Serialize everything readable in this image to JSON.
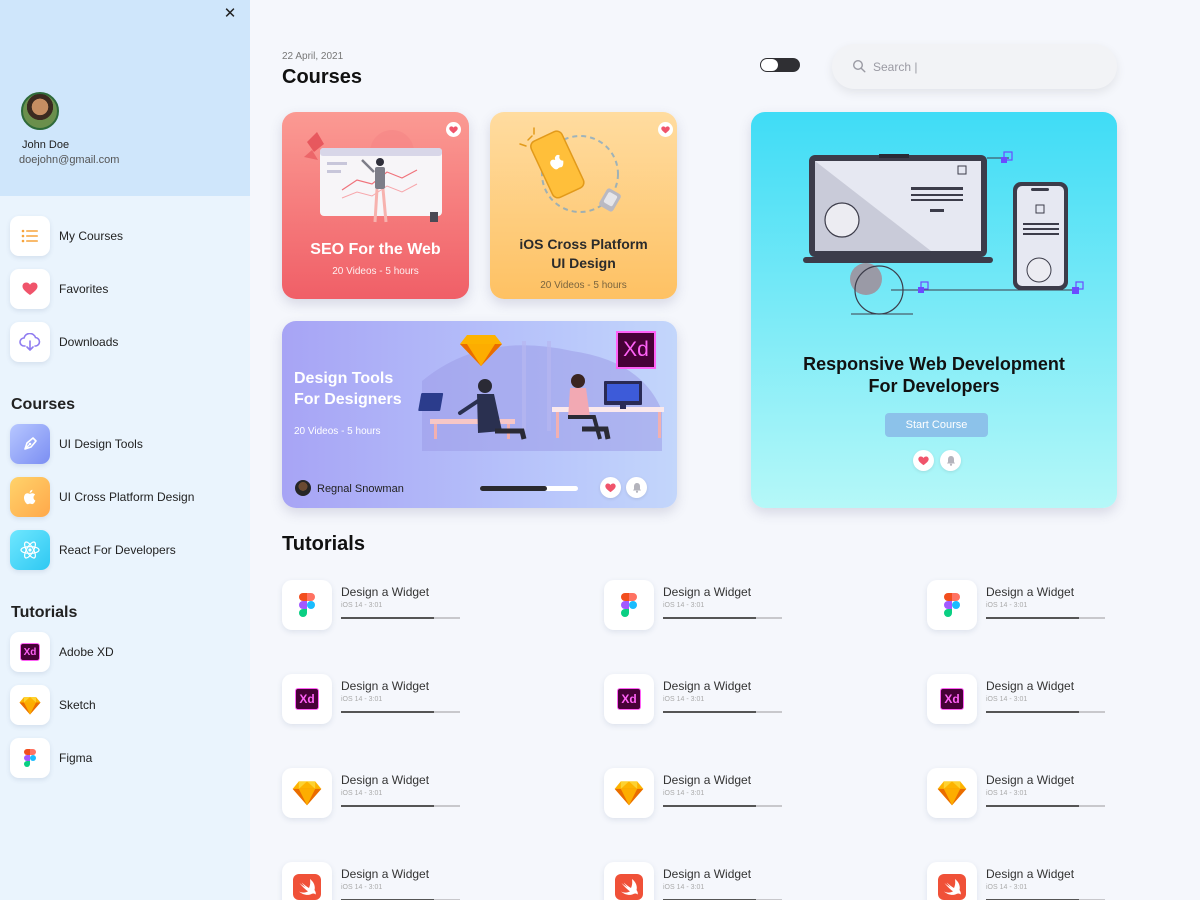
{
  "user": {
    "name": "John Doe",
    "email": "doejohn@gmail.com"
  },
  "close_icon": "✕",
  "sidebar": {
    "main_items": [
      {
        "label": "My Courses",
        "icon": "list-icon"
      },
      {
        "label": "Favorites",
        "icon": "heart-icon"
      },
      {
        "label": "Downloads",
        "icon": "cloud-download-icon"
      }
    ],
    "courses_heading": "Courses",
    "course_items": [
      {
        "label": "UI Design Tools",
        "icon": "pen-tool-icon"
      },
      {
        "label": "UI Cross Platform Design",
        "icon": "apple-icon"
      },
      {
        "label": "React For Developers",
        "icon": "react-icon"
      }
    ],
    "tutorials_heading": "Tutorials",
    "tutorial_items": [
      {
        "label": "Adobe XD",
        "icon": "adobe-xd-icon"
      },
      {
        "label": "Sketch",
        "icon": "sketch-icon"
      },
      {
        "label": "Figma",
        "icon": "figma-icon"
      }
    ]
  },
  "header": {
    "date": "22 April, 2021",
    "title": "Courses",
    "search_placeholder": "Search |"
  },
  "cards": {
    "seo": {
      "title": "SEO For the Web",
      "meta": "20 Videos - 5 hours"
    },
    "ios": {
      "title_line1": "iOS Cross Platform",
      "title_line2": "UI Design",
      "meta": "20 Videos - 5 hours"
    },
    "tools": {
      "xd_badge": "Xd",
      "title_line1": "Design Tools",
      "title_line2": "For Designers",
      "meta": "20 Videos - 5 hours",
      "author": "Regnal Snowman",
      "progress": 0.68
    },
    "web": {
      "title_line1": "Responsive Web Development",
      "title_line2": "For Developers",
      "button": "Start Course"
    }
  },
  "tutorials": {
    "heading": "Tutorials",
    "rows": [
      {
        "icon": "figma-icon",
        "items": [
          {
            "name": "Design a Widget",
            "meta": "iOS 14 - 3:01",
            "progress": 0.78
          },
          {
            "name": "Design a Widget",
            "meta": "iOS 14 - 3:01",
            "progress": 0.78
          },
          {
            "name": "Design a Widget",
            "meta": "iOS 14 - 3:01",
            "progress": 0.78
          }
        ]
      },
      {
        "icon": "adobe-xd-icon",
        "items": [
          {
            "name": "Design a Widget",
            "meta": "iOS 14 - 3:01",
            "progress": 0.78
          },
          {
            "name": "Design a Widget",
            "meta": "iOS 14 - 3:01",
            "progress": 0.78
          },
          {
            "name": "Design a Widget",
            "meta": "iOS 14 - 3:01",
            "progress": 0.78
          }
        ]
      },
      {
        "icon": "sketch-icon",
        "items": [
          {
            "name": "Design a Widget",
            "meta": "iOS 14 - 3:01",
            "progress": 0.78
          },
          {
            "name": "Design a Widget",
            "meta": "iOS 14 - 3:01",
            "progress": 0.78
          },
          {
            "name": "Design a Widget",
            "meta": "iOS 14 - 3:01",
            "progress": 0.78
          }
        ]
      },
      {
        "icon": "swift-icon",
        "items": [
          {
            "name": "Design a Widget",
            "meta": "iOS 14 - 3:01",
            "progress": 0.78
          },
          {
            "name": "Design a Widget",
            "meta": "iOS 14 - 3:01",
            "progress": 0.78
          },
          {
            "name": "Design a Widget",
            "meta": "iOS 14 - 3:01",
            "progress": 0.78
          }
        ]
      }
    ]
  },
  "colors": {
    "sidebar_bg": "#eaf4fd",
    "profile_bg": "#cfe6fb",
    "seo_card": "#f36b70",
    "ios_card": "#fec163",
    "tools_card": "#a7a4f5",
    "web_card": "#3fdcf6",
    "heart": "#f0546b"
  }
}
